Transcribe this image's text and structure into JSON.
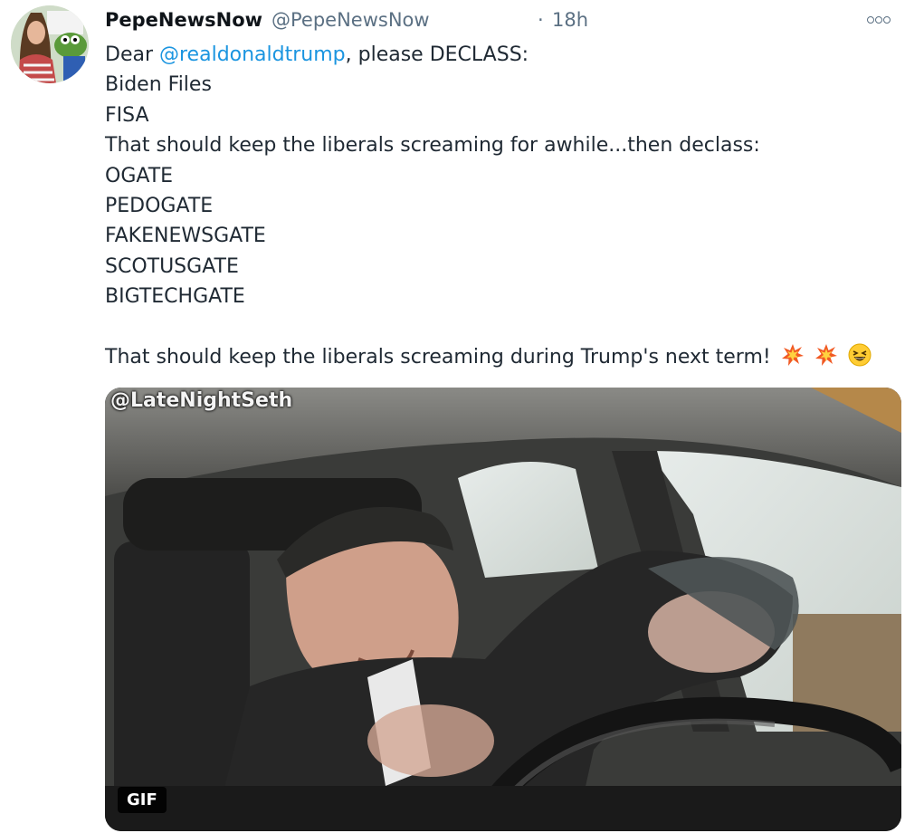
{
  "tweet": {
    "display_name": "PepeNewsNow",
    "handle": "@PepeNewsNow",
    "separator": "·",
    "time": "18h",
    "more_icon": "more-options-icon",
    "lines": [
      {
        "pre": "Dear ",
        "mention": "@realdonaldtrump",
        "post": ", please DECLASS:"
      },
      {
        "text": "Biden Files"
      },
      {
        "text": "FISA"
      },
      {
        "text": "That should keep the liberals screaming for awhile...then declass:"
      },
      {
        "text": "OGATE"
      },
      {
        "text": "PEDOGATE"
      },
      {
        "text": "FAKENEWSGATE"
      },
      {
        "text": "SCOTUSGATE"
      },
      {
        "text": "BIGTECHGATE"
      }
    ],
    "closing_line": "That should keep the liberals screaming during Trump's next term!",
    "emojis": [
      "collision-emoji",
      "collision-emoji",
      "grinning-squinting-emoji"
    ]
  },
  "media": {
    "watermark": "@LateNightSeth",
    "badge": "GIF"
  },
  "colors": {
    "mention": "#1b95e0",
    "secondary_text": "#5b7083"
  }
}
